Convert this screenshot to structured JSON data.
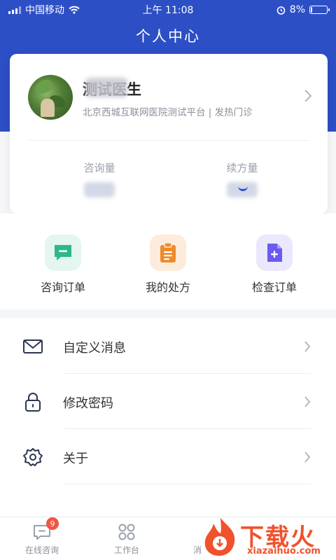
{
  "status_bar": {
    "carrier": "中国移动",
    "time": "上午 11:08",
    "battery": "8%",
    "battery_level": 0.08
  },
  "header": {
    "title": "个人中心"
  },
  "profile": {
    "name": "测试医生",
    "hospital": "北京西城互联网医院测试平台 | 发热门诊",
    "stats": [
      {
        "label": "咨询量"
      },
      {
        "label": "续方量"
      }
    ]
  },
  "quick_actions": [
    {
      "label": "咨询订单",
      "icon": "chat-minus-icon",
      "color": "#2eb88a",
      "bg": "#e4f6ef"
    },
    {
      "label": "我的处方",
      "icon": "clipboard-icon",
      "color": "#f08a2a",
      "bg": "#fdecdc"
    },
    {
      "label": "检查订单",
      "icon": "document-plus-icon",
      "color": "#6a5af0",
      "bg": "#ebe8fd"
    }
  ],
  "menu": [
    {
      "label": "自定义消息",
      "icon": "envelope-icon"
    },
    {
      "label": "修改密码",
      "icon": "lock-icon"
    },
    {
      "label": "关于",
      "icon": "gear-icon"
    }
  ],
  "tabbar": {
    "tabs": [
      {
        "label": "在线咨询",
        "icon": "message-icon",
        "badge": "9"
      },
      {
        "label": "工作台",
        "icon": "grid-icon"
      },
      {
        "label": "消",
        "icon": "chat-icon"
      }
    ]
  },
  "watermark": {
    "text": "下载火",
    "url": "xiazaihuo.com"
  },
  "colors": {
    "primary": "#2d4fc6",
    "badge": "#f05542",
    "watermark": "#f0522d"
  }
}
